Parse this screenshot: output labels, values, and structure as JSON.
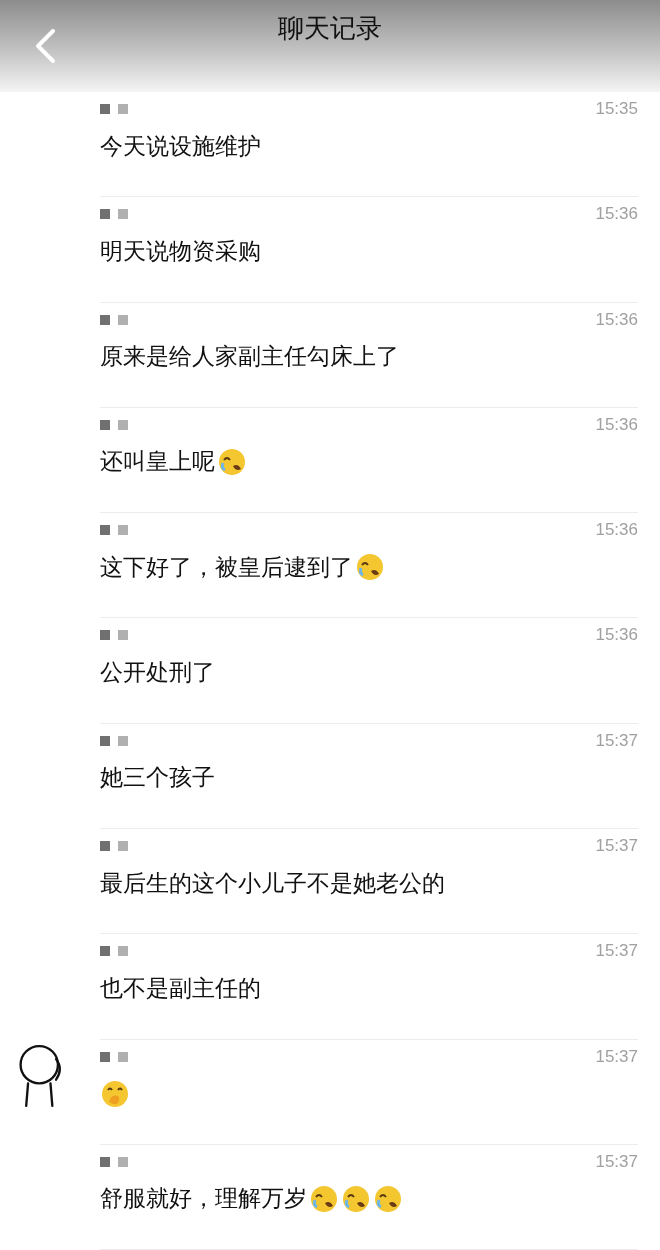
{
  "header": {
    "title": "聊天记录"
  },
  "messages": [
    {
      "time": "15:35",
      "text": "今天说设施维护"
    },
    {
      "time": "15:36",
      "text": "明天说物资采购"
    },
    {
      "time": "15:36",
      "text": "原来是给人家副主任勾床上了"
    },
    {
      "time": "15:36",
      "text": "还叫皇上呢",
      "emojis": [
        {
          "kind": "laugh-cry"
        }
      ]
    },
    {
      "time": "15:36",
      "text": "这下好了，被皇后逮到了",
      "emojis": [
        {
          "kind": "laugh-cry"
        }
      ]
    },
    {
      "time": "15:36",
      "text": "公开处刑了"
    },
    {
      "time": "15:37",
      "text": "她三个孩子"
    },
    {
      "time": "15:37",
      "text": "最后生的这个小儿子不是她老公的"
    },
    {
      "time": "15:37",
      "text": "也不是副主任的"
    },
    {
      "time": "15:37",
      "avatar": true,
      "emojis": [
        {
          "kind": "cover-mouth"
        }
      ]
    },
    {
      "time": "15:37",
      "text": "舒服就好，理解万岁",
      "emojis": [
        {
          "kind": "laugh-cry"
        },
        {
          "kind": "laugh-cry"
        },
        {
          "kind": "laugh-cry"
        }
      ]
    }
  ]
}
